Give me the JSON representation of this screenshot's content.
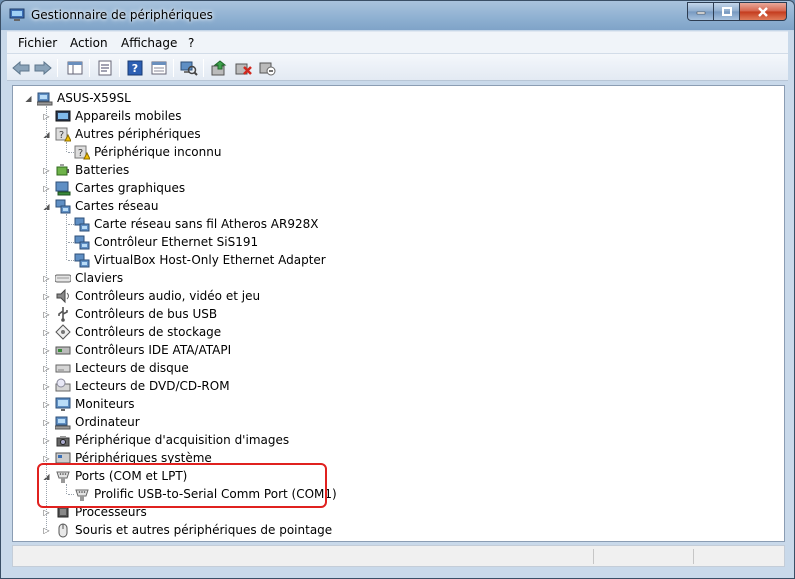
{
  "window": {
    "title": "Gestionnaire de périphériques"
  },
  "menu": {
    "items": [
      "Fichier",
      "Action",
      "Affichage",
      "?"
    ]
  },
  "toolbar": {
    "buttons": [
      "back-arrow-icon",
      "forward-arrow-icon",
      "console-tree-icon",
      "properties-icon",
      "help-icon",
      "show-hidden-icon",
      "scan-hardware-icon",
      "update-driver-icon",
      "uninstall-icon",
      "disable-icon"
    ]
  },
  "tree": {
    "root": "ASUS-X59SL",
    "categories": [
      {
        "label": "Appareils mobiles",
        "expanded": false,
        "children": []
      },
      {
        "label": "Autres périphériques",
        "expanded": true,
        "children": [
          "Périphérique inconnu"
        ]
      },
      {
        "label": "Batteries",
        "expanded": false,
        "children": []
      },
      {
        "label": "Cartes graphiques",
        "expanded": false,
        "children": []
      },
      {
        "label": "Cartes réseau",
        "expanded": true,
        "children": [
          "Carte réseau sans fil Atheros AR928X",
          "Contrôleur Ethernet SiS191",
          "VirtualBox Host-Only Ethernet Adapter"
        ]
      },
      {
        "label": "Claviers",
        "expanded": false,
        "children": []
      },
      {
        "label": "Contrôleurs audio, vidéo et jeu",
        "expanded": false,
        "children": []
      },
      {
        "label": "Contrôleurs de bus USB",
        "expanded": false,
        "children": []
      },
      {
        "label": "Contrôleurs de stockage",
        "expanded": false,
        "children": []
      },
      {
        "label": "Contrôleurs IDE ATA/ATAPI",
        "expanded": false,
        "children": []
      },
      {
        "label": "Lecteurs de disque",
        "expanded": false,
        "children": []
      },
      {
        "label": "Lecteurs de DVD/CD-ROM",
        "expanded": false,
        "children": []
      },
      {
        "label": "Moniteurs",
        "expanded": false,
        "children": []
      },
      {
        "label": "Ordinateur",
        "expanded": false,
        "children": []
      },
      {
        "label": "Périphérique d'acquisition d'images",
        "expanded": false,
        "children": []
      },
      {
        "label": "Périphériques système",
        "expanded": false,
        "children": []
      },
      {
        "label": "Ports (COM et LPT)",
        "expanded": true,
        "children": [
          "Prolific USB-to-Serial Comm Port (COM1)"
        ]
      },
      {
        "label": "Processeurs",
        "expanded": false,
        "children": []
      },
      {
        "label": "Souris et autres périphériques de pointage",
        "expanded": false,
        "children": []
      }
    ]
  },
  "icons": {
    "categories": [
      "mobile-device-icon",
      "unknown-device-icon",
      "battery-icon",
      "display-adapter-icon",
      "network-adapter-icon",
      "keyboard-icon",
      "audio-icon",
      "usb-icon",
      "storage-icon",
      "ide-icon",
      "disk-drive-icon",
      "dvd-drive-icon",
      "monitor-icon",
      "computer-icon",
      "imaging-icon",
      "system-device-icon",
      "port-icon",
      "processor-icon",
      "mouse-icon"
    ]
  },
  "colors": {
    "highlight": "#e0211f",
    "title_gradient": "#8eb0d1",
    "warning": "#f4c000"
  }
}
